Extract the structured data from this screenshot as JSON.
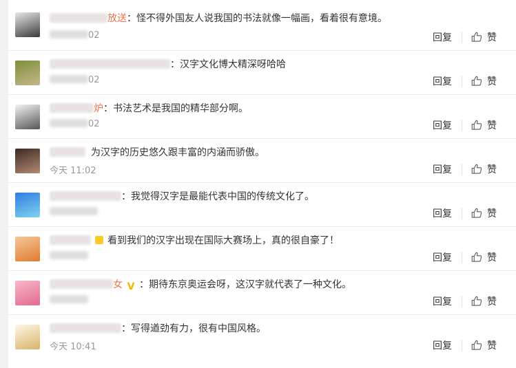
{
  "actions": {
    "reply_label": "回复",
    "like_label": "赞"
  },
  "comments": [
    {
      "name_visible": "放送",
      "comment": "：怪不得外国友人说我国的书法就像一幅画，看着很有意境。",
      "time": "02",
      "badge": ""
    },
    {
      "name_visible": "",
      "comment": "：汉字文化博大精深呀哈哈",
      "time": "02",
      "badge": ""
    },
    {
      "name_visible": "炉",
      "comment": "：书法艺术是我国的精华部分啊。",
      "time": "02",
      "badge": ""
    },
    {
      "name_visible": "",
      "comment": "为汉字的历史悠久跟丰富的内涵而骄傲。",
      "time": "今天 11:02",
      "badge": ""
    },
    {
      "name_visible": "",
      "comment": "：我觉得汉字是最能代表中国的传统文化了。",
      "time": "",
      "badge": ""
    },
    {
      "name_visible": "",
      "comment": "看到我们的汉字出现在国际大赛场上，真的很自豪了！",
      "time": "",
      "badge": "yellow"
    },
    {
      "name_visible": "女",
      "comment": "：期待东京奥运会呀，这汉字就代表了一种文化。",
      "time": "",
      "badge": "v"
    },
    {
      "name_visible": "",
      "comment": "：写得遒劲有力，很有中国风格。",
      "time": "今天 10:41",
      "badge": ""
    }
  ],
  "colors": {
    "username": "#eb7350",
    "time": "#999999"
  },
  "icons": {
    "like": "thumbs-up-icon"
  }
}
